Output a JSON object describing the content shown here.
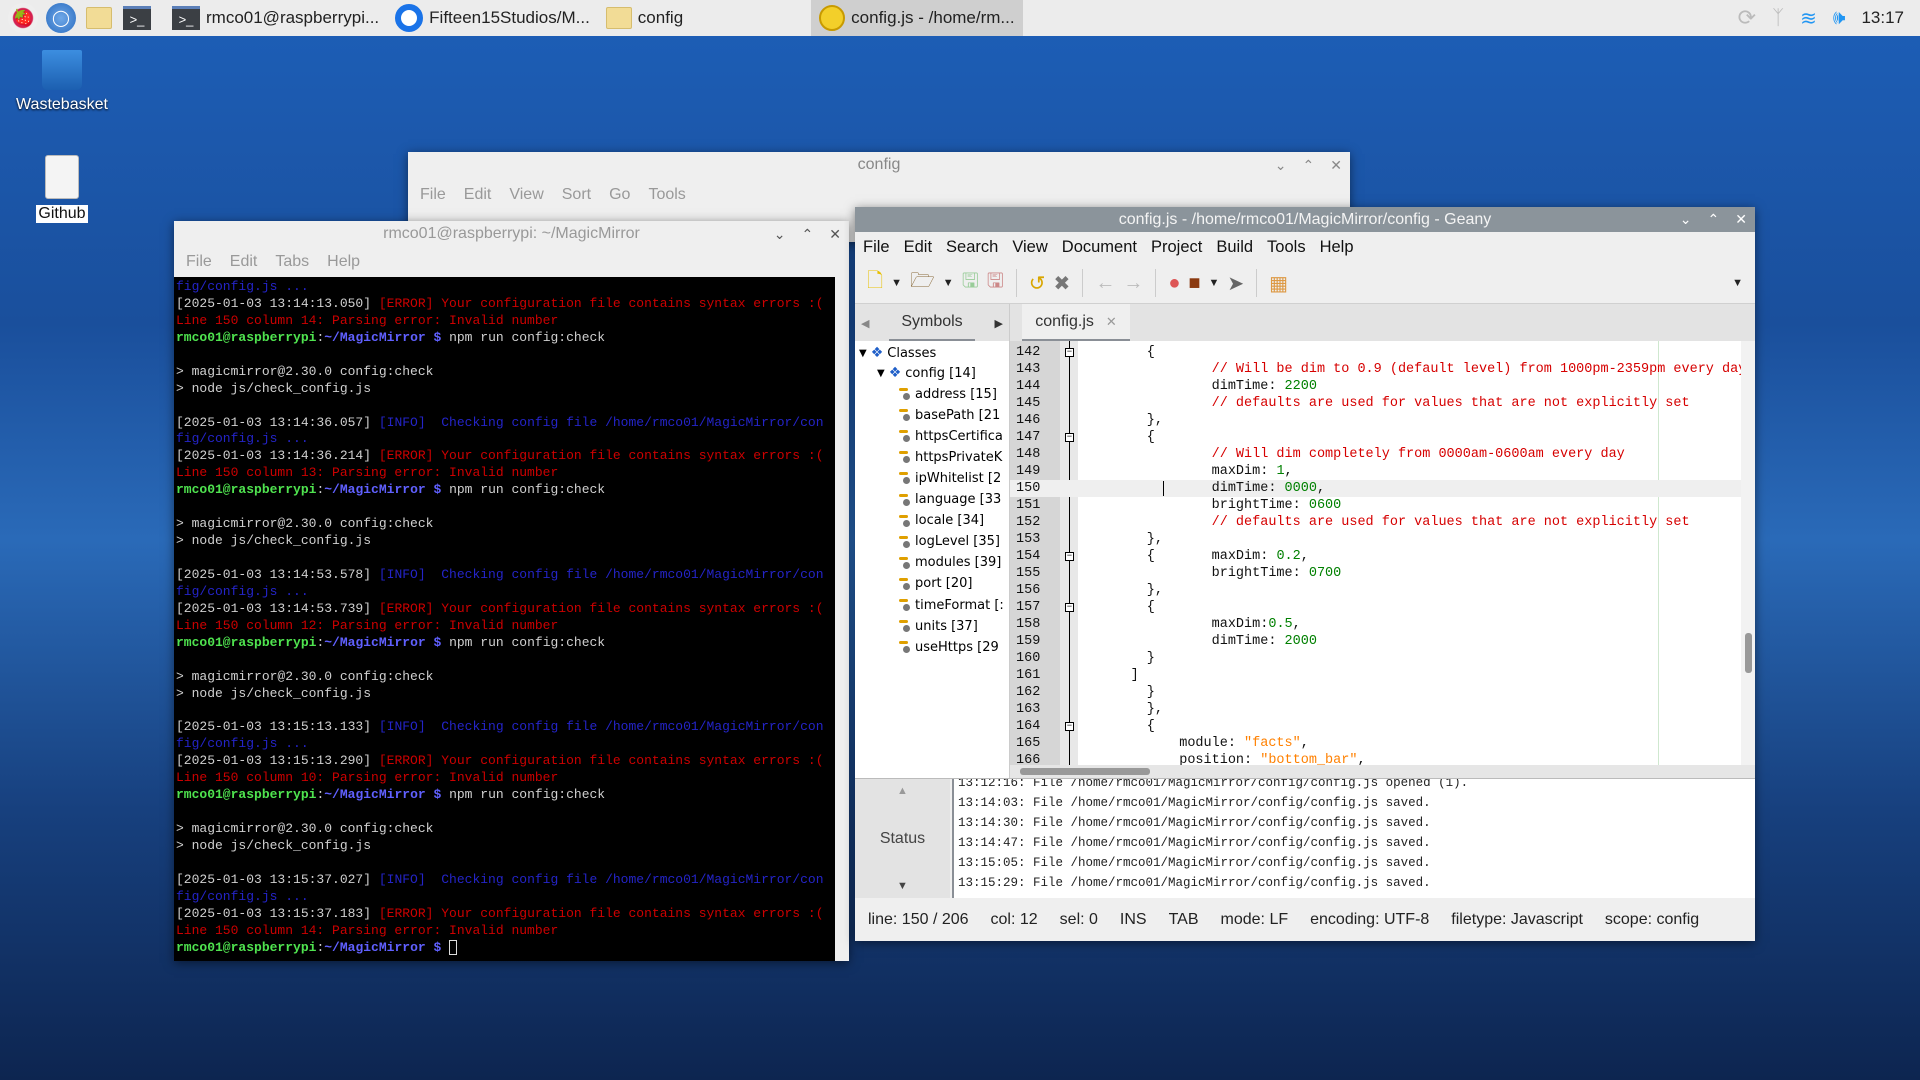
{
  "taskbar": {
    "launchers": [
      {
        "icon": "raspberry-menu-icon"
      },
      {
        "icon": "web-browser-icon"
      },
      {
        "icon": "file-manager-icon"
      },
      {
        "icon": "terminal-icon"
      }
    ],
    "tasks": [
      {
        "icon": "terminal-icon",
        "label": "rmco01@raspberrypi..."
      },
      {
        "icon": "chromium-icon",
        "label": "Fifteen15Studios/M..."
      },
      {
        "icon": "folder-icon",
        "label": "config"
      },
      {
        "icon": "geany-icon",
        "label": "config.js - /home/rm...",
        "active": true
      }
    ],
    "tray": {
      "icons": [
        "sync-icon",
        "bluetooth-icon",
        "wifi-icon",
        "volume-icon"
      ],
      "clock": "13:17"
    },
    "accent": "#2196f3"
  },
  "desktop": {
    "icons": [
      {
        "label": "Wastebasket",
        "icon": "trash-icon"
      },
      {
        "label": "Github",
        "icon": "text-file-icon"
      }
    ]
  },
  "file_manager": {
    "title": "config",
    "menu": [
      "File",
      "Edit",
      "View",
      "Sort",
      "Go",
      "Tools"
    ]
  },
  "terminal": {
    "title": "rmco01@raspberrypi: ~/MagicMirror",
    "menu": [
      "File",
      "Edit",
      "Tabs",
      "Help"
    ],
    "lines": [
      [
        [
          "info",
          "fig/config.js ..."
        ]
      ],
      [
        [
          "ts",
          "[2025-01-03 13:14:13.050] "
        ],
        [
          "err",
          "[ERROR] Your configuration file contains syntax errors :("
        ]
      ],
      [
        [
          "err",
          "Line 150 column 14: Parsing error: Invalid number"
        ]
      ],
      [
        [
          "user",
          "rmco01@raspberrypi"
        ],
        [
          "txt",
          ":"
        ],
        [
          "path",
          "~/MagicMirror $"
        ],
        [
          "txt",
          " npm run config:check"
        ]
      ],
      [],
      [
        [
          "txt",
          "> magicmirror@2.30.0 config:check"
        ]
      ],
      [
        [
          "txt",
          "> node js/check_config.js"
        ]
      ],
      [],
      [
        [
          "ts",
          "[2025-01-03 13:14:36.057] "
        ],
        [
          "info",
          "[INFO]  Checking config file /home/rmco01/MagicMirror/con"
        ]
      ],
      [
        [
          "info",
          "fig/config.js ..."
        ]
      ],
      [
        [
          "ts",
          "[2025-01-03 13:14:36.214] "
        ],
        [
          "err",
          "[ERROR] Your configuration file contains syntax errors :("
        ]
      ],
      [
        [
          "err",
          "Line 150 column 13: Parsing error: Invalid number"
        ]
      ],
      [
        [
          "user",
          "rmco01@raspberrypi"
        ],
        [
          "txt",
          ":"
        ],
        [
          "path",
          "~/MagicMirror $"
        ],
        [
          "txt",
          " npm run config:check"
        ]
      ],
      [],
      [
        [
          "txt",
          "> magicmirror@2.30.0 config:check"
        ]
      ],
      [
        [
          "txt",
          "> node js/check_config.js"
        ]
      ],
      [],
      [
        [
          "ts",
          "[2025-01-03 13:14:53.578] "
        ],
        [
          "info",
          "[INFO]  Checking config file /home/rmco01/MagicMirror/con"
        ]
      ],
      [
        [
          "info",
          "fig/config.js ..."
        ]
      ],
      [
        [
          "ts",
          "[2025-01-03 13:14:53.739] "
        ],
        [
          "err",
          "[ERROR] Your configuration file contains syntax errors :("
        ]
      ],
      [
        [
          "err",
          "Line 150 column 12: Parsing error: Invalid number"
        ]
      ],
      [
        [
          "user",
          "rmco01@raspberrypi"
        ],
        [
          "txt",
          ":"
        ],
        [
          "path",
          "~/MagicMirror $"
        ],
        [
          "txt",
          " npm run config:check"
        ]
      ],
      [],
      [
        [
          "txt",
          "> magicmirror@2.30.0 config:check"
        ]
      ],
      [
        [
          "txt",
          "> node js/check_config.js"
        ]
      ],
      [],
      [
        [
          "ts",
          "[2025-01-03 13:15:13.133] "
        ],
        [
          "info",
          "[INFO]  Checking config file /home/rmco01/MagicMirror/con"
        ]
      ],
      [
        [
          "info",
          "fig/config.js ..."
        ]
      ],
      [
        [
          "ts",
          "[2025-01-03 13:15:13.290] "
        ],
        [
          "err",
          "[ERROR] Your configuration file contains syntax errors :("
        ]
      ],
      [
        [
          "err",
          "Line 150 column 10: Parsing error: Invalid number"
        ]
      ],
      [
        [
          "user",
          "rmco01@raspberrypi"
        ],
        [
          "txt",
          ":"
        ],
        [
          "path",
          "~/MagicMirror $"
        ],
        [
          "txt",
          " npm run config:check"
        ]
      ],
      [],
      [
        [
          "txt",
          "> magicmirror@2.30.0 config:check"
        ]
      ],
      [
        [
          "txt",
          "> node js/check_config.js"
        ]
      ],
      [],
      [
        [
          "ts",
          "[2025-01-03 13:15:37.027] "
        ],
        [
          "info",
          "[INFO]  Checking config file /home/rmco01/MagicMirror/con"
        ]
      ],
      [
        [
          "info",
          "fig/config.js ..."
        ]
      ],
      [
        [
          "ts",
          "[2025-01-03 13:15:37.183] "
        ],
        [
          "err",
          "[ERROR] Your configuration file contains syntax errors :("
        ]
      ],
      [
        [
          "err",
          "Line 150 column 14: Parsing error: Invalid number"
        ]
      ],
      [
        [
          "user",
          "rmco01@raspberrypi"
        ],
        [
          "txt",
          ":"
        ],
        [
          "path",
          "~/MagicMirror $"
        ],
        [
          "txt",
          " "
        ]
      ]
    ]
  },
  "geany": {
    "title": "config.js - /home/rmco01/MagicMirror/config - Geany",
    "menu": [
      "File",
      "Edit",
      "Search",
      "View",
      "Document",
      "Project",
      "Build",
      "Tools",
      "Help"
    ],
    "toolbar": [
      "new-file-icon",
      "open-file-icon",
      "save-icon",
      "save-all-icon",
      "revert-icon",
      "close-icon",
      "back-icon",
      "forward-icon",
      "compile-icon",
      "build-icon",
      "execute-icon",
      "color-chooser-icon"
    ],
    "sidebar_tab": "Symbols",
    "file_tab": "config.js",
    "symbols": {
      "root": "Classes",
      "class": "config [14]",
      "items": [
        "address [15]",
        "basePath [21",
        "httpsCertifica",
        "httpsPrivateK",
        "ipWhitelist [2",
        "language [33",
        "locale [34]",
        "logLevel [35]",
        "modules [39]",
        "port [20]",
        "timeFormat [:",
        "units [37]",
        "useHttps [29"
      ]
    },
    "current_line": 150,
    "code": [
      {
        "n": "142",
        "fold": true,
        "t": [
          [
            "plain",
            "        {"
          ]
        ]
      },
      {
        "n": "143",
        "t": [
          [
            "cm",
            "                // Will be dim to 0.9 (default level) from 1000pm-2359pm every day"
          ]
        ]
      },
      {
        "n": "144",
        "t": [
          [
            "plain",
            "                dimTime: "
          ],
          [
            "num",
            "2200"
          ]
        ]
      },
      {
        "n": "145",
        "t": [
          [
            "cm",
            "                // defaults are used for values that are not explicitly set"
          ]
        ]
      },
      {
        "n": "146",
        "t": [
          [
            "plain",
            "        },"
          ]
        ]
      },
      {
        "n": "147",
        "fold": true,
        "t": [
          [
            "plain",
            "        {"
          ]
        ]
      },
      {
        "n": "148",
        "t": [
          [
            "cm",
            "                // Will dim completely from 0000am-0600am every day"
          ]
        ]
      },
      {
        "n": "149",
        "t": [
          [
            "plain",
            "                maxDim: "
          ],
          [
            "num",
            "1"
          ],
          [
            "plain",
            ","
          ]
        ]
      },
      {
        "n": "150",
        "t": [
          [
            "plain",
            "                dimTime: "
          ],
          [
            "num",
            "0000"
          ],
          [
            "plain",
            ","
          ]
        ]
      },
      {
        "n": "151",
        "t": [
          [
            "plain",
            "                brightTime: "
          ],
          [
            "num",
            "0600"
          ]
        ]
      },
      {
        "n": "152",
        "t": [
          [
            "cm",
            "                // defaults are used for values that are not explicitly set"
          ]
        ]
      },
      {
        "n": "153",
        "t": [
          [
            "plain",
            "        },"
          ]
        ]
      },
      {
        "n": "154",
        "fold": true,
        "t": [
          [
            "plain",
            "        {       maxDim: "
          ],
          [
            "num",
            "0.2"
          ],
          [
            "plain",
            ","
          ]
        ]
      },
      {
        "n": "155",
        "t": [
          [
            "plain",
            "                brightTime: "
          ],
          [
            "num",
            "0700"
          ]
        ]
      },
      {
        "n": "156",
        "t": [
          [
            "plain",
            "        },"
          ]
        ]
      },
      {
        "n": "157",
        "fold": true,
        "t": [
          [
            "plain",
            "        {"
          ]
        ]
      },
      {
        "n": "158",
        "t": [
          [
            "plain",
            "                maxDim:"
          ],
          [
            "num",
            "0.5"
          ],
          [
            "plain",
            ","
          ]
        ]
      },
      {
        "n": "159",
        "t": [
          [
            "plain",
            "                dimTime: "
          ],
          [
            "num",
            "2000"
          ]
        ]
      },
      {
        "n": "160",
        "t": [
          [
            "plain",
            "        }"
          ]
        ]
      },
      {
        "n": "161",
        "t": [
          [
            "plain",
            "      ]"
          ]
        ]
      },
      {
        "n": "162",
        "t": [
          [
            "plain",
            "        }"
          ]
        ]
      },
      {
        "n": "163",
        "t": [
          [
            "plain",
            "        },"
          ]
        ]
      },
      {
        "n": "164",
        "fold": true,
        "t": [
          [
            "plain",
            "        {"
          ]
        ]
      },
      {
        "n": "165",
        "t": [
          [
            "plain",
            "            module: "
          ],
          [
            "str",
            "\"facts\""
          ],
          [
            "plain",
            ","
          ]
        ]
      },
      {
        "n": "166",
        "t": [
          [
            "plain",
            "            position: "
          ],
          [
            "str",
            "\"bottom_bar\""
          ],
          [
            "plain",
            ","
          ]
        ]
      }
    ],
    "messages_tab": "Status",
    "messages": [
      "13:12:16: File /home/rmco01/MagicMirror/config/config.js opened (1).",
      "13:14:03: File /home/rmco01/MagicMirror/config/config.js saved.",
      "13:14:30: File /home/rmco01/MagicMirror/config/config.js saved.",
      "13:14:47: File /home/rmco01/MagicMirror/config/config.js saved.",
      "13:15:05: File /home/rmco01/MagicMirror/config/config.js saved.",
      "13:15:29: File /home/rmco01/MagicMirror/config/config.js saved."
    ],
    "status": {
      "line": "line: 150 / 206",
      "col": "col: 12",
      "sel": "sel: 0",
      "ins": "INS",
      "tab": "TAB",
      "mode": "mode: LF",
      "encoding": "encoding: UTF-8",
      "filetype": "filetype: Javascript",
      "scope": "scope: config"
    }
  }
}
